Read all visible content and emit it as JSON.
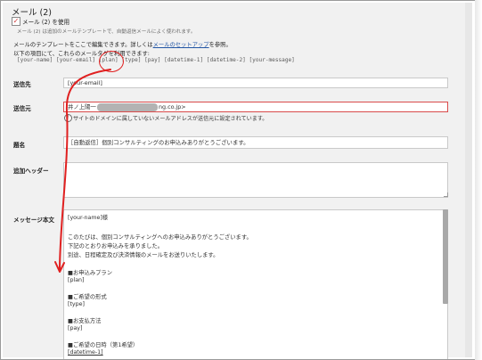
{
  "section_title": "メール (2)",
  "use_mail2": {
    "checked_mark": "✓",
    "label": "メール (2) を使用",
    "description": "メール (2) は追加のメールテンプレートで、自動返信メールによく使われます。"
  },
  "info": {
    "line1_before": "メールのテンプレートをここで編集できます。詳しくは",
    "line1_link": "メールのセットアップ",
    "line1_after": "を参照。",
    "line2": "以下の項目にて、これらのメールタグを利用できます:",
    "tags": "[your-name] [your-email] [plan] [type] [pay] [datetime-1] [datetime-2] [your-message]"
  },
  "fields": {
    "to": {
      "label": "送信先",
      "value": "[your-email]"
    },
    "from": {
      "label": "送信元",
      "value_prefix": "井ノ上陽一",
      "value_suffix": "ng.co.jp>",
      "warning": "サイトのドメインに属していないメールアドレスが送信元に設定されています。"
    },
    "subject": {
      "label": "題名",
      "value": "［自動返信］個別コンサルティングのお申込みありがとうございます。"
    },
    "headers": {
      "label": "追加ヘッダー",
      "value": ""
    },
    "body": {
      "label": "メッセージ本文",
      "lines": [
        "[your-name]様",
        "",
        "このたびは、個別コンサルティングへのお申込みありがとうございます。",
        "下記のとおりお申込みを承りました。",
        "別途、日程確定及び決済情報のメールをお送りいたします。",
        "",
        "■お申込みプラン",
        "[plan]",
        "",
        "■ご希望の形式",
        "[type]",
        "",
        "■お支払方法",
        "[pay]",
        "",
        "■ご希望の日時（第1希望）",
        "[datetime-1]"
      ]
    }
  },
  "annotation": {
    "color": "#e02020"
  }
}
